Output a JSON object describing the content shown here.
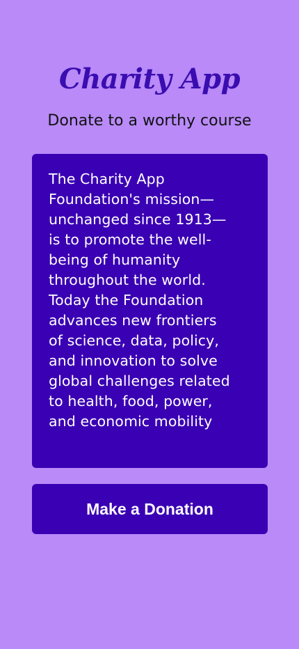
{
  "app": {
    "title": "Charity App",
    "tagline": "Donate to a worthy course"
  },
  "mission": {
    "text": "The Charity App\nFoundation's mission—\nunchanged since 1913—\nis to promote the well-\nbeing of humanity\nthroughout the world.\nToday the Foundation\nadvances new frontiers\nof science, data, policy,\nand innovation to solve\nglobal challenges related\nto health, food, power,\nand economic mobility"
  },
  "actions": {
    "donate_label": "Make a Donation"
  },
  "colors": {
    "background": "#b98af8",
    "accent": "#3a00b3",
    "title": "#3a0db0",
    "on_accent": "#ffffff"
  }
}
